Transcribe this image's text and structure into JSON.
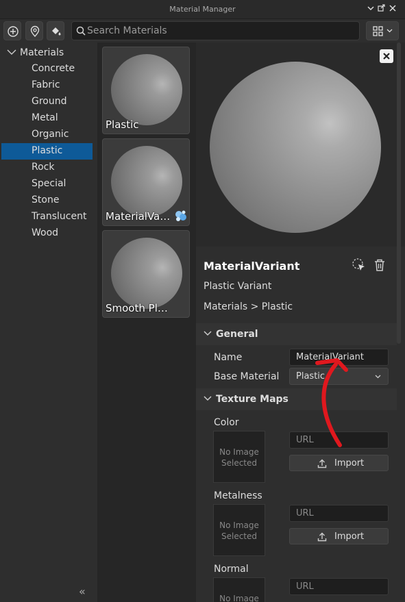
{
  "window": {
    "title": "Material Manager"
  },
  "search": {
    "placeholder": "Search Materials"
  },
  "sidebar": {
    "root_label": "Materials",
    "items": [
      {
        "label": "Concrete"
      },
      {
        "label": "Fabric"
      },
      {
        "label": "Ground"
      },
      {
        "label": "Metal"
      },
      {
        "label": "Organic"
      },
      {
        "label": "Plastic",
        "selected": true
      },
      {
        "label": "Rock"
      },
      {
        "label": "Special"
      },
      {
        "label": "Stone"
      },
      {
        "label": "Translucent"
      },
      {
        "label": "Wood"
      }
    ],
    "collapse_glyph": "«"
  },
  "grid": {
    "tiles": [
      {
        "label": "Plastic"
      },
      {
        "label": "MaterialVariant",
        "variant": true
      },
      {
        "label": "Smooth Plastic"
      }
    ]
  },
  "details": {
    "title": "MaterialVariant",
    "subtitle": "Plastic Variant",
    "path": "Materials > Plastic",
    "general": {
      "header": "General",
      "name_label": "Name",
      "name_value": "MaterialVariant",
      "base_label": "Base Material",
      "base_value": "Plastic"
    },
    "texture_maps": {
      "header": "Texture Maps",
      "maps": [
        {
          "label": "Color",
          "thumb_text": "No Image Selected",
          "url_placeholder": "URL",
          "import_label": "Import"
        },
        {
          "label": "Metalness",
          "thumb_text": "No Image Selected",
          "url_placeholder": "URL",
          "import_label": "Import"
        },
        {
          "label": "Normal",
          "thumb_text": "No Image",
          "url_placeholder": "URL"
        }
      ]
    }
  },
  "colors": {
    "selection": "#0e5a98",
    "annotation": "#e0181e"
  }
}
